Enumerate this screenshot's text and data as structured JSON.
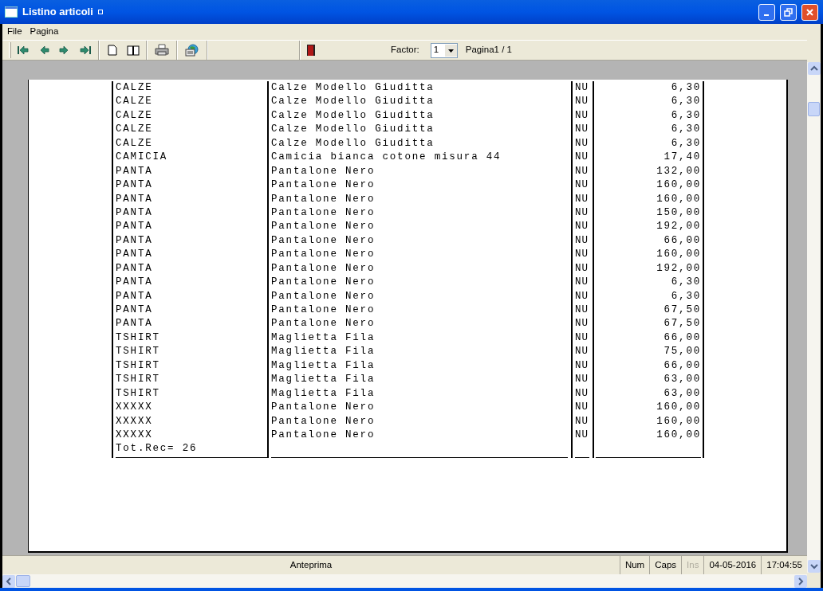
{
  "window": {
    "title": "Listino articoli"
  },
  "menu": [
    "File",
    "Pagina"
  ],
  "toolbar": {
    "factor_label": "Factor:",
    "factor_value": "1",
    "page_info": "Pagina1 / 1"
  },
  "report": {
    "rows": [
      {
        "code": "CALZE",
        "description": "Calze Modello Giuditta",
        "unit": "NU",
        "price": "6,30"
      },
      {
        "code": "CALZE",
        "description": "Calze Modello Giuditta",
        "unit": "NU",
        "price": "6,30"
      },
      {
        "code": "CALZE",
        "description": "Calze Modello Giuditta",
        "unit": "NU",
        "price": "6,30"
      },
      {
        "code": "CALZE",
        "description": "Calze Modello Giuditta",
        "unit": "NU",
        "price": "6,30"
      },
      {
        "code": "CALZE",
        "description": "Calze Modello Giuditta",
        "unit": "NU",
        "price": "6,30"
      },
      {
        "code": "CAMICIA",
        "description": "Camicia bianca cotone misura 44",
        "unit": "NU",
        "price": "17,40"
      },
      {
        "code": "PANTA",
        "description": "Pantalone Nero",
        "unit": "NU",
        "price": "132,00"
      },
      {
        "code": "PANTA",
        "description": "Pantalone Nero",
        "unit": "NU",
        "price": "160,00"
      },
      {
        "code": "PANTA",
        "description": "Pantalone Nero",
        "unit": "NU",
        "price": "160,00"
      },
      {
        "code": "PANTA",
        "description": "Pantalone Nero",
        "unit": "NU",
        "price": "150,00"
      },
      {
        "code": "PANTA",
        "description": "Pantalone Nero",
        "unit": "NU",
        "price": "192,00"
      },
      {
        "code": "PANTA",
        "description": "Pantalone Nero",
        "unit": "NU",
        "price": "66,00"
      },
      {
        "code": "PANTA",
        "description": "Pantalone Nero",
        "unit": "NU",
        "price": "160,00"
      },
      {
        "code": "PANTA",
        "description": "Pantalone Nero",
        "unit": "NU",
        "price": "192,00"
      },
      {
        "code": "PANTA",
        "description": "Pantalone Nero",
        "unit": "NU",
        "price": "6,30"
      },
      {
        "code": "PANTA",
        "description": "Pantalone Nero",
        "unit": "NU",
        "price": "6,30"
      },
      {
        "code": "PANTA",
        "description": "Pantalone Nero",
        "unit": "NU",
        "price": "67,50"
      },
      {
        "code": "PANTA",
        "description": "Pantalone Nero",
        "unit": "NU",
        "price": "67,50"
      },
      {
        "code": "TSHIRT",
        "description": "Maglietta Fila",
        "unit": "NU",
        "price": "66,00"
      },
      {
        "code": "TSHIRT",
        "description": "Maglietta Fila",
        "unit": "NU",
        "price": "75,00"
      },
      {
        "code": "TSHIRT",
        "description": "Maglietta Fila",
        "unit": "NU",
        "price": "66,00"
      },
      {
        "code": "TSHIRT",
        "description": "Maglietta Fila",
        "unit": "NU",
        "price": "63,00"
      },
      {
        "code": "TSHIRT",
        "description": "Maglietta Fila",
        "unit": "NU",
        "price": "63,00"
      },
      {
        "code": "XXXXX",
        "description": "Pantalone Nero",
        "unit": "NU",
        "price": "160,00"
      },
      {
        "code": "XXXXX",
        "description": "Pantalone Nero",
        "unit": "NU",
        "price": "160,00"
      },
      {
        "code": "XXXXX",
        "description": "Pantalone Nero",
        "unit": "NU",
        "price": "160,00"
      }
    ],
    "total": "Tot.Rec= 26"
  },
  "status_bar": [
    {
      "kind": "message",
      "text": "Anteprima",
      "disabled": false
    },
    {
      "kind": "panel",
      "text": "Num",
      "disabled": false
    },
    {
      "kind": "panel",
      "text": "Caps",
      "disabled": false
    },
    {
      "kind": "panel",
      "text": "Ins",
      "disabled": true
    },
    {
      "kind": "panel",
      "text": "04-05-2016",
      "disabled": false
    },
    {
      "kind": "panel",
      "text": "17:04:55",
      "disabled": false
    }
  ]
}
